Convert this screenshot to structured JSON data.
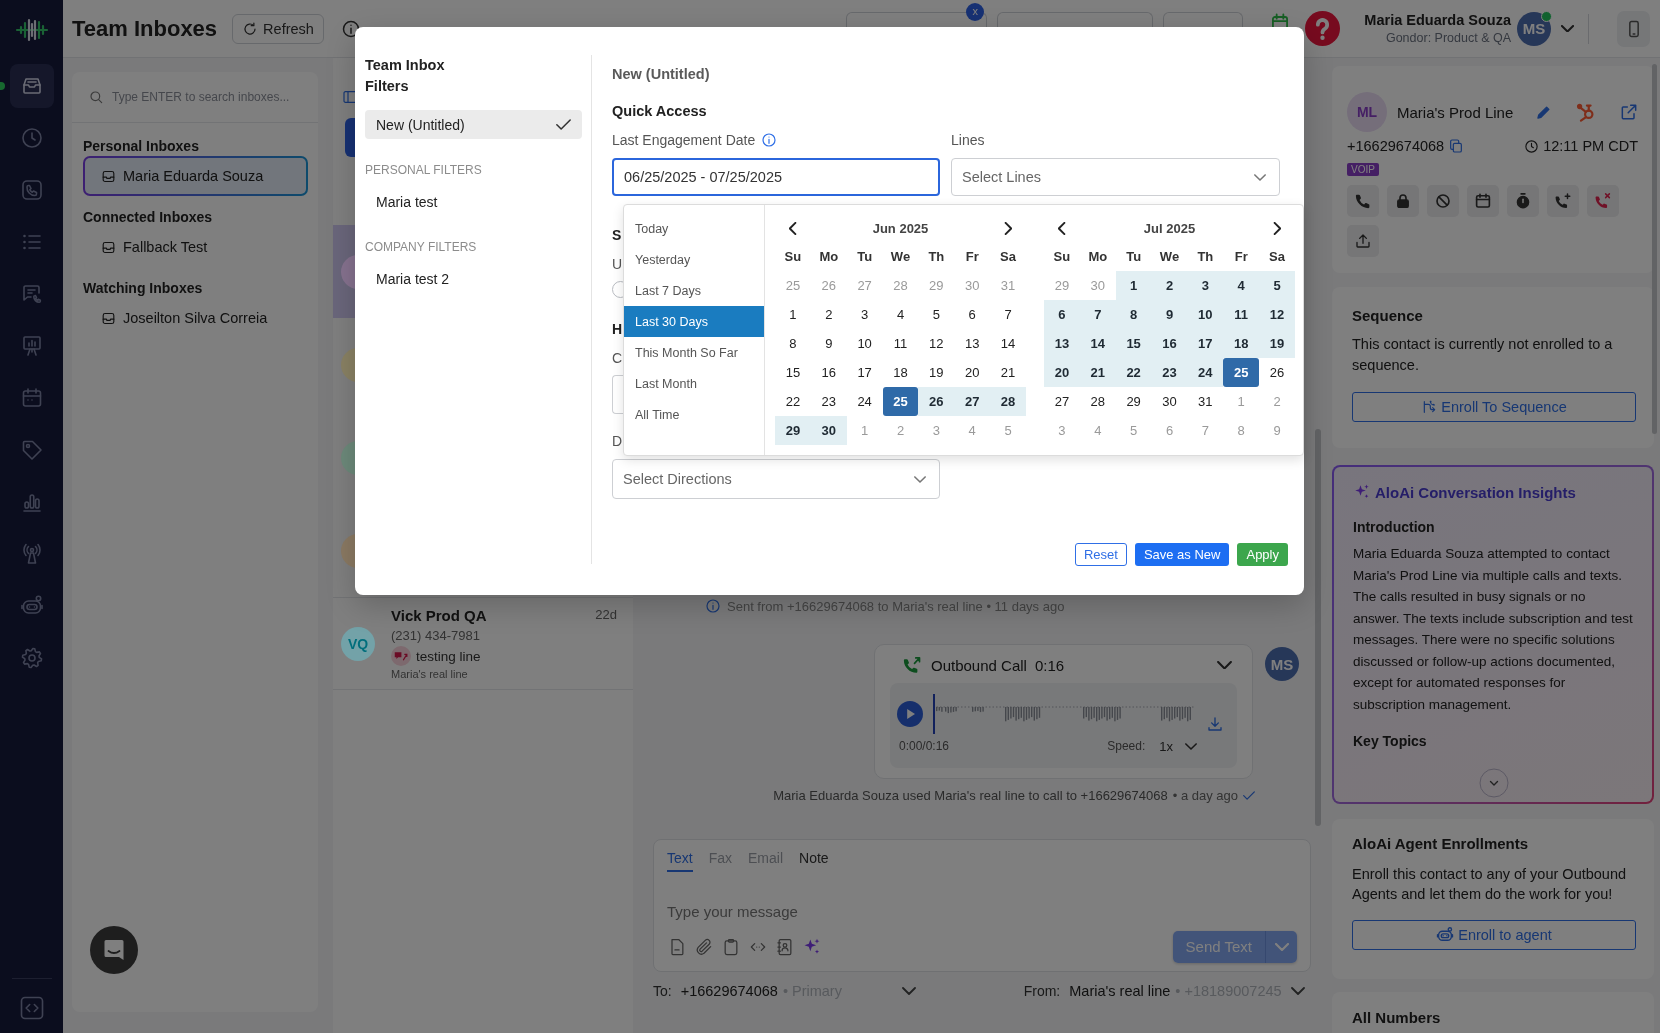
{
  "nav_rail": {
    "items": [
      {
        "selected": true
      },
      {
        "selected": false
      },
      {
        "selected": false
      },
      {
        "selected": false
      },
      {
        "selected": false
      },
      {
        "selected": false
      },
      {
        "selected": false
      },
      {
        "selected": false
      },
      {
        "selected": false
      },
      {
        "selected": false
      },
      {
        "selected": false
      },
      {
        "selected": false
      }
    ]
  },
  "header": {
    "title": "Team Inboxes",
    "refresh_button": "Refresh",
    "tour_badge": "x",
    "user": {
      "name": "Maria Eduarda Souza",
      "org": "Gondor: Product & QA",
      "initials": "MS",
      "online": true
    }
  },
  "inbox_panel": {
    "search": {
      "placeholder": "Type ENTER to search inboxes..."
    },
    "groups": [
      {
        "title": "Personal Inboxes",
        "items": [
          {
            "name": "Maria Eduarda Souza",
            "selected": true
          }
        ]
      },
      {
        "title": "Connected Inboxes",
        "items": [
          {
            "name": "Fallback Test",
            "selected": false
          }
        ]
      },
      {
        "title": "Watching Inboxes",
        "items": [
          {
            "name": "Joseilton Silva Correia",
            "selected": false
          }
        ]
      }
    ]
  },
  "conversation_list": {
    "items": [
      {
        "selected": true,
        "color": "#86728f"
      },
      {
        "selected": false,
        "color": "#8a8264"
      },
      {
        "selected": false,
        "color": "#6d8a7b"
      },
      {
        "selected": false,
        "color": "#8b7a63"
      },
      {
        "selected": false,
        "color": "#73a2a8",
        "initials": "VQ",
        "name": "Vick Prod QA",
        "time": "22d",
        "phone": "(231) 434-7981",
        "line": "testing line",
        "via": "Maria's real line"
      }
    ]
  },
  "conversation": {
    "system_note": "Sent from +16629674068 to Maria's real line • 11 days ago",
    "call": {
      "title": "Outbound Call",
      "duration": "0:16",
      "level": 0,
      "time": "0:00/0:16",
      "speed_label": "Speed:",
      "speed": "1x",
      "initials": "MS",
      "caption": "Maria Eduarda Souza used Maria's real line to call to +16629674068",
      "ago": "• a day ago",
      "delivered": true
    }
  },
  "composer": {
    "tabs": [
      {
        "label": "Text",
        "selected": true,
        "disabled": false
      },
      {
        "label": "Fax",
        "selected": false,
        "disabled": true
      },
      {
        "label": "Email",
        "selected": false,
        "disabled": true
      },
      {
        "label": "Note",
        "selected": false,
        "disabled": false
      }
    ],
    "placeholder": "Type your message",
    "send_button": "Send Text",
    "to_label": "To:",
    "to_number": "+16629674068",
    "to_tag": "• Primary",
    "from_label": "From:",
    "from_line": "Maria's real line",
    "from_number": "• +18189007245"
  },
  "contact_panel": {
    "contact": {
      "initials": "ML",
      "name": "Maria's Prod Line",
      "phone": "+16629674068",
      "local_time": "12:11 PM CDT",
      "badge": "VOIP"
    },
    "sequence": {
      "title": "Sequence",
      "text": "This contact is currently not enrolled to a sequence.",
      "button": "Enroll To Sequence"
    },
    "insights": {
      "title": "AloAi Conversation Insights",
      "sections": [
        {
          "heading": "Introduction",
          "text": "Maria Eduarda Souza attempted to contact Maria's Prod Line via multiple calls and texts. The calls resulted in busy signals or no answer. The texts include subscription and test messages. There were no specific solutions discussed or follow-up actions documented, except for automated responses for subscription management."
        },
        {
          "heading": "Key Topics"
        }
      ]
    },
    "agents": {
      "title": "AloAi Agent Enrollments",
      "text": "Enroll this contact to any of your Outbound Agents and let them do the work for you!",
      "button": "Enroll to agent"
    },
    "numbers": {
      "title": "All Numbers"
    }
  },
  "filter_dialog": {
    "sidebar": {
      "title": "Team Inbox Filters",
      "current": {
        "label": "New (Untitled)",
        "selected": true
      },
      "groups": [
        {
          "heading": "PERSONAL FILTERS",
          "items": [
            {
              "label": "Maria test",
              "selected": false
            }
          ]
        },
        {
          "heading": "COMPANY FILTERS",
          "items": [
            {
              "label": "Maria test 2",
              "selected": false
            }
          ]
        }
      ]
    },
    "form": {
      "title": "New (Untitled)",
      "section": "Quick Access",
      "date_label": "Last Engagement Date",
      "date_value": "06/25/2025 - 07/25/2025",
      "lines_label": "Lines",
      "lines_placeholder": "Select Lines",
      "covered_fields": [
        {
          "kind": "heading",
          "text": "S"
        },
        {
          "kind": "label",
          "text": "U"
        },
        {
          "kind": "radio",
          "checked": false
        },
        {
          "kind": "heading",
          "text": "H"
        },
        {
          "kind": "label",
          "text": "C"
        },
        {
          "kind": "input"
        },
        {
          "kind": "label",
          "text": "D"
        }
      ],
      "directions_placeholder": "Select Directions"
    },
    "date_picker": {
      "ranges": [
        {
          "label": "Today",
          "selected": false
        },
        {
          "label": "Yesterday",
          "selected": false
        },
        {
          "label": "Last 7 Days",
          "selected": false
        },
        {
          "label": "Last 30 Days",
          "selected": true
        },
        {
          "label": "This Month So Far",
          "selected": false
        },
        {
          "label": "Last Month",
          "selected": false
        },
        {
          "label": "All Time",
          "selected": false
        }
      ],
      "months": [
        {
          "title": "Jun 2025",
          "weekdays": [
            "Su",
            "Mo",
            "Tu",
            "We",
            "Th",
            "Fr",
            "Sa"
          ],
          "weeks": [
            [
              {
                "day": "25",
                "muted": true,
                "in_range": false,
                "selected": false
              },
              {
                "day": "26",
                "muted": true,
                "in_range": false,
                "selected": false
              },
              {
                "day": "27",
                "muted": true,
                "in_range": false,
                "selected": false
              },
              {
                "day": "28",
                "muted": true,
                "in_range": false,
                "selected": false
              },
              {
                "day": "29",
                "muted": true,
                "in_range": false,
                "selected": false
              },
              {
                "day": "30",
                "muted": true,
                "in_range": false,
                "selected": false
              },
              {
                "day": "31",
                "muted": true,
                "in_range": false,
                "selected": false
              }
            ],
            [
              {
                "day": "1",
                "muted": false,
                "in_range": false,
                "selected": false
              },
              {
                "day": "2",
                "muted": false,
                "in_range": false,
                "selected": false
              },
              {
                "day": "3",
                "muted": false,
                "in_range": false,
                "selected": false
              },
              {
                "day": "4",
                "muted": false,
                "in_range": false,
                "selected": false
              },
              {
                "day": "5",
                "muted": false,
                "in_range": false,
                "selected": false
              },
              {
                "day": "6",
                "muted": false,
                "in_range": false,
                "selected": false
              },
              {
                "day": "7",
                "muted": false,
                "in_range": false,
                "selected": false
              }
            ],
            [
              {
                "day": "8",
                "muted": false,
                "in_range": false,
                "selected": false
              },
              {
                "day": "9",
                "muted": false,
                "in_range": false,
                "selected": false
              },
              {
                "day": "10",
                "muted": false,
                "in_range": false,
                "selected": false
              },
              {
                "day": "11",
                "muted": false,
                "in_range": false,
                "selected": false
              },
              {
                "day": "12",
                "muted": false,
                "in_range": false,
                "selected": false
              },
              {
                "day": "13",
                "muted": false,
                "in_range": false,
                "selected": false
              },
              {
                "day": "14",
                "muted": false,
                "in_range": false,
                "selected": false
              }
            ],
            [
              {
                "day": "15",
                "muted": false,
                "in_range": false,
                "selected": false
              },
              {
                "day": "16",
                "muted": false,
                "in_range": false,
                "selected": false
              },
              {
                "day": "17",
                "muted": false,
                "in_range": false,
                "selected": false
              },
              {
                "day": "18",
                "muted": false,
                "in_range": false,
                "selected": false
              },
              {
                "day": "19",
                "muted": false,
                "in_range": false,
                "selected": false
              },
              {
                "day": "20",
                "muted": false,
                "in_range": false,
                "selected": false
              },
              {
                "day": "21",
                "muted": false,
                "in_range": false,
                "selected": false
              }
            ],
            [
              {
                "day": "22",
                "muted": false,
                "in_range": false,
                "selected": false
              },
              {
                "day": "23",
                "muted": false,
                "in_range": false,
                "selected": false
              },
              {
                "day": "24",
                "muted": false,
                "in_range": false,
                "selected": false
              },
              {
                "day": "25",
                "muted": false,
                "in_range": false,
                "selected": true
              },
              {
                "day": "26",
                "muted": false,
                "in_range": true,
                "selected": false
              },
              {
                "day": "27",
                "muted": false,
                "in_range": true,
                "selected": false
              },
              {
                "day": "28",
                "muted": false,
                "in_range": true,
                "selected": false
              }
            ],
            [
              {
                "day": "29",
                "muted": false,
                "in_range": true,
                "selected": false
              },
              {
                "day": "30",
                "muted": false,
                "in_range": true,
                "selected": false
              },
              {
                "day": "1",
                "muted": true,
                "in_range": false,
                "selected": false
              },
              {
                "day": "2",
                "muted": true,
                "in_range": false,
                "selected": false
              },
              {
                "day": "3",
                "muted": true,
                "in_range": false,
                "selected": false
              },
              {
                "day": "4",
                "muted": true,
                "in_range": false,
                "selected": false
              },
              {
                "day": "5",
                "muted": true,
                "in_range": false,
                "selected": false
              }
            ]
          ]
        },
        {
          "title": "Jul 2025",
          "weekdays": [
            "Su",
            "Mo",
            "Tu",
            "We",
            "Th",
            "Fr",
            "Sa"
          ],
          "weeks": [
            [
              {
                "day": "29",
                "muted": true,
                "in_range": false,
                "selected": false
              },
              {
                "day": "30",
                "muted": true,
                "in_range": false,
                "selected": false
              },
              {
                "day": "1",
                "muted": false,
                "in_range": true,
                "selected": false
              },
              {
                "day": "2",
                "muted": false,
                "in_range": true,
                "selected": false
              },
              {
                "day": "3",
                "muted": false,
                "in_range": true,
                "selected": false
              },
              {
                "day": "4",
                "muted": false,
                "in_range": true,
                "selected": false
              },
              {
                "day": "5",
                "muted": false,
                "in_range": true,
                "selected": false
              }
            ],
            [
              {
                "day": "6",
                "muted": false,
                "in_range": true,
                "selected": false
              },
              {
                "day": "7",
                "muted": false,
                "in_range": true,
                "selected": false
              },
              {
                "day": "8",
                "muted": false,
                "in_range": true,
                "selected": false
              },
              {
                "day": "9",
                "muted": false,
                "in_range": true,
                "selected": false
              },
              {
                "day": "10",
                "muted": false,
                "in_range": true,
                "selected": false
              },
              {
                "day": "11",
                "muted": false,
                "in_range": true,
                "selected": false
              },
              {
                "day": "12",
                "muted": false,
                "in_range": true,
                "selected": false
              }
            ],
            [
              {
                "day": "13",
                "muted": false,
                "in_range": true,
                "selected": false
              },
              {
                "day": "14",
                "muted": false,
                "in_range": true,
                "selected": false
              },
              {
                "day": "15",
                "muted": false,
                "in_range": true,
                "selected": false
              },
              {
                "day": "16",
                "muted": false,
                "in_range": true,
                "selected": false
              },
              {
                "day": "17",
                "muted": false,
                "in_range": true,
                "selected": false
              },
              {
                "day": "18",
                "muted": false,
                "in_range": true,
                "selected": false
              },
              {
                "day": "19",
                "muted": false,
                "in_range": true,
                "selected": false
              }
            ],
            [
              {
                "day": "20",
                "muted": false,
                "in_range": true,
                "selected": false
              },
              {
                "day": "21",
                "muted": false,
                "in_range": true,
                "selected": false
              },
              {
                "day": "22",
                "muted": false,
                "in_range": true,
                "selected": false
              },
              {
                "day": "23",
                "muted": false,
                "in_range": true,
                "selected": false
              },
              {
                "day": "24",
                "muted": false,
                "in_range": true,
                "selected": false
              },
              {
                "day": "25",
                "muted": false,
                "in_range": false,
                "selected": true
              },
              {
                "day": "26",
                "muted": false,
                "in_range": false,
                "selected": false
              }
            ],
            [
              {
                "day": "27",
                "muted": false,
                "in_range": false,
                "selected": false
              },
              {
                "day": "28",
                "muted": false,
                "in_range": false,
                "selected": false
              },
              {
                "day": "29",
                "muted": false,
                "in_range": false,
                "selected": false
              },
              {
                "day": "30",
                "muted": false,
                "in_range": false,
                "selected": false
              },
              {
                "day": "31",
                "muted": false,
                "in_range": false,
                "selected": false
              },
              {
                "day": "1",
                "muted": true,
                "in_range": false,
                "selected": false
              },
              {
                "day": "2",
                "muted": true,
                "in_range": false,
                "selected": false
              }
            ],
            [
              {
                "day": "3",
                "muted": true,
                "in_range": false,
                "selected": false
              },
              {
                "day": "4",
                "muted": true,
                "in_range": false,
                "selected": false
              },
              {
                "day": "5",
                "muted": true,
                "in_range": false,
                "selected": false
              },
              {
                "day": "6",
                "muted": true,
                "in_range": false,
                "selected": false
              },
              {
                "day": "7",
                "muted": true,
                "in_range": false,
                "selected": false
              },
              {
                "day": "8",
                "muted": true,
                "in_range": false,
                "selected": false
              },
              {
                "day": "9",
                "muted": true,
                "in_range": false,
                "selected": false
              }
            ]
          ]
        }
      ]
    },
    "buttons": [
      {
        "label": "Reset",
        "kind": "outline"
      },
      {
        "label": "Save as New",
        "kind": "primary"
      },
      {
        "label": "Apply",
        "kind": "success"
      }
    ]
  }
}
